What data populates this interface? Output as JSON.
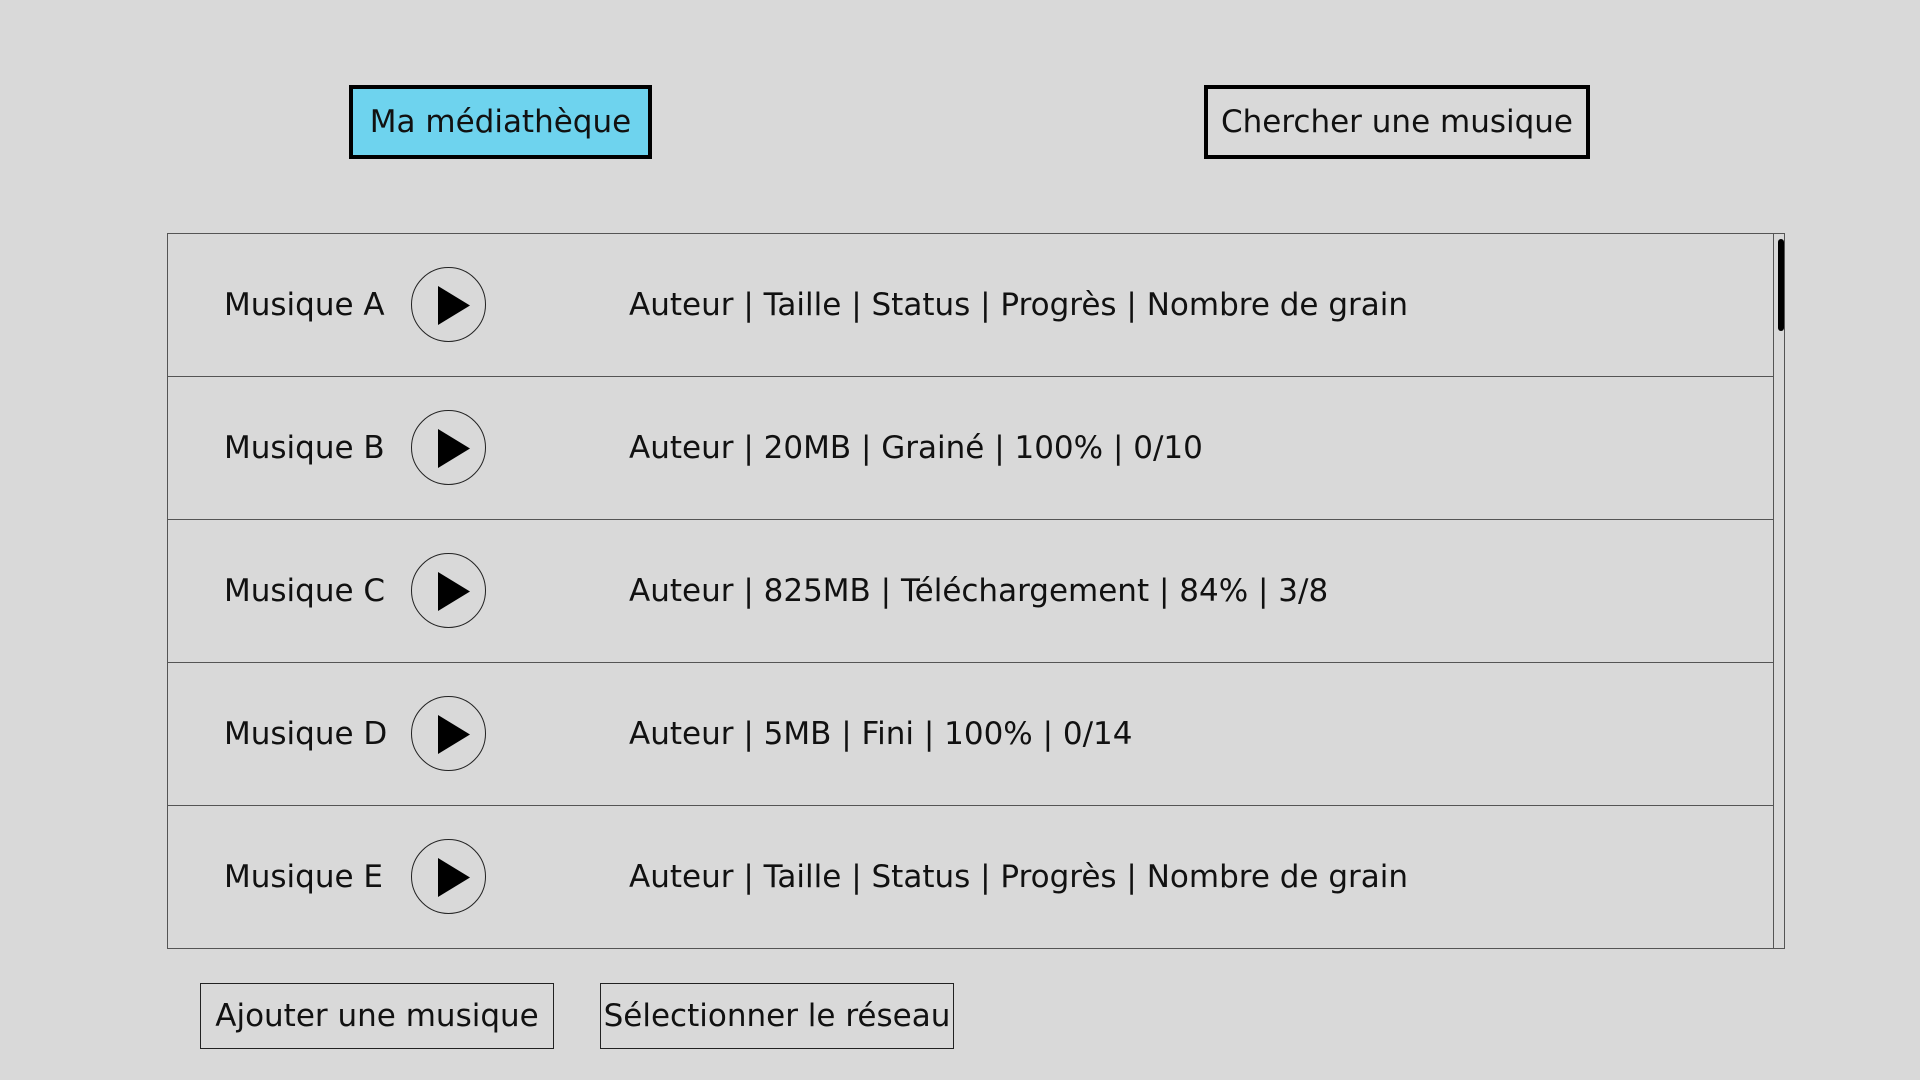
{
  "tabs": {
    "library_label": "Ma médiathèque",
    "search_label": "Chercher une musique",
    "active": "library",
    "active_color": "#6ed3ee"
  },
  "tracks": [
    {
      "title": "Musique A",
      "info": "Auteur | Taille | Status | Progrès | Nombre de grain",
      "play_icon": "play-icon"
    },
    {
      "title": "Musique B",
      "info": "Auteur | 20MB | Grainé | 100% | 0/10",
      "play_icon": "play-icon"
    },
    {
      "title": "Musique C",
      "info": "Auteur | 825MB | Téléchargement | 84% | 3/8",
      "play_icon": "play-icon"
    },
    {
      "title": "Musique D",
      "info": "Auteur | 5MB | Fini | 100% | 0/14",
      "play_icon": "play-icon"
    },
    {
      "title": "Musique E",
      "info": "Auteur | Taille | Status | Progrès | Nombre de grain",
      "play_icon": "play-icon"
    }
  ],
  "actions": {
    "add_label": "Ajouter une musique",
    "network_label": "Sélectionner le réseau"
  }
}
